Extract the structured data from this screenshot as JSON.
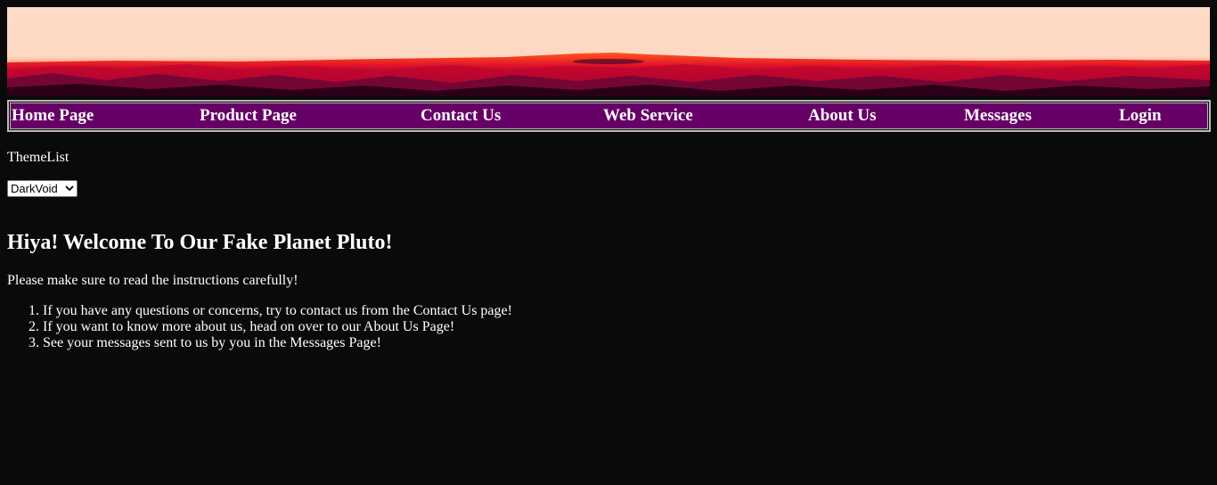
{
  "banner": {
    "image_name": "sunset-horizon-banner",
    "colors": [
      "#fddcc6",
      "#ff5a1a",
      "#d4002a",
      "#6a0030",
      "#2a0018"
    ]
  },
  "nav": {
    "background": "#660066",
    "items": [
      {
        "label": "Home Page"
      },
      {
        "label": "Product Page"
      },
      {
        "label": "Contact Us"
      },
      {
        "label": "Web Service"
      },
      {
        "label": "About Us"
      },
      {
        "label": "Messages"
      },
      {
        "label": "Login"
      }
    ]
  },
  "theme": {
    "label": "ThemeList",
    "selected": "DarkVoid",
    "chevron_icon": "chevron-down-icon"
  },
  "main": {
    "heading": "Hiya! Welcome To Our Fake Planet Pluto!",
    "intro": "Please make sure to read the instructions carefully!",
    "steps": [
      "If you have any questions or concerns, try to contact us from the Contact Us page!",
      "If you want to know more about us, head on over to our About Us Page!",
      "See your messages sent to us by you in the Messages Page!"
    ]
  }
}
